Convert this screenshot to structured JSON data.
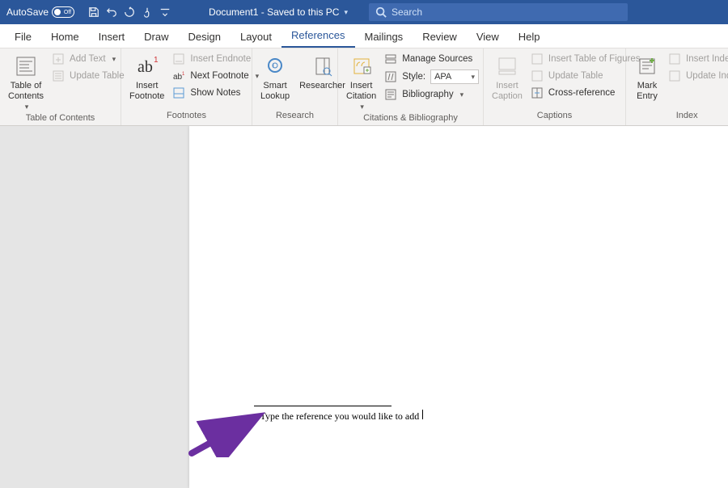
{
  "titlebar": {
    "autosave": "AutoSave",
    "autosave_state": "Off",
    "doc_title": "Document1  -  Saved to this PC",
    "search_placeholder": "Search"
  },
  "tabs": [
    "File",
    "Home",
    "Insert",
    "Draw",
    "Design",
    "Layout",
    "References",
    "Mailings",
    "Review",
    "View",
    "Help"
  ],
  "active_tab": "References",
  "ribbon": {
    "toc": {
      "table_of_contents": "Table of\nContents",
      "add_text": "Add Text",
      "update_table": "Update Table",
      "group": "Table of Contents"
    },
    "footnotes": {
      "insert_footnote": "Insert\nFootnote",
      "insert_endnote": "Insert Endnote",
      "next_footnote": "Next Footnote",
      "show_notes": "Show Notes",
      "group": "Footnotes"
    },
    "research": {
      "smart_lookup": "Smart\nLookup",
      "researcher": "Researcher",
      "group": "Research"
    },
    "citations": {
      "insert_citation": "Insert\nCitation",
      "manage_sources": "Manage Sources",
      "style_label": "Style:",
      "style_value": "APA",
      "bibliography": "Bibliography",
      "group": "Citations & Bibliography"
    },
    "captions": {
      "insert_caption": "Insert\nCaption",
      "insert_tof": "Insert Table of Figures",
      "update_table": "Update Table",
      "cross_reference": "Cross-reference",
      "group": "Captions"
    },
    "index": {
      "mark_entry": "Mark\nEntry",
      "insert_index": "Insert Index",
      "update_index": "Update Index",
      "group": "Index"
    }
  },
  "document": {
    "footnote_number": "1",
    "footnote_text": "Type the reference you would like to add"
  }
}
